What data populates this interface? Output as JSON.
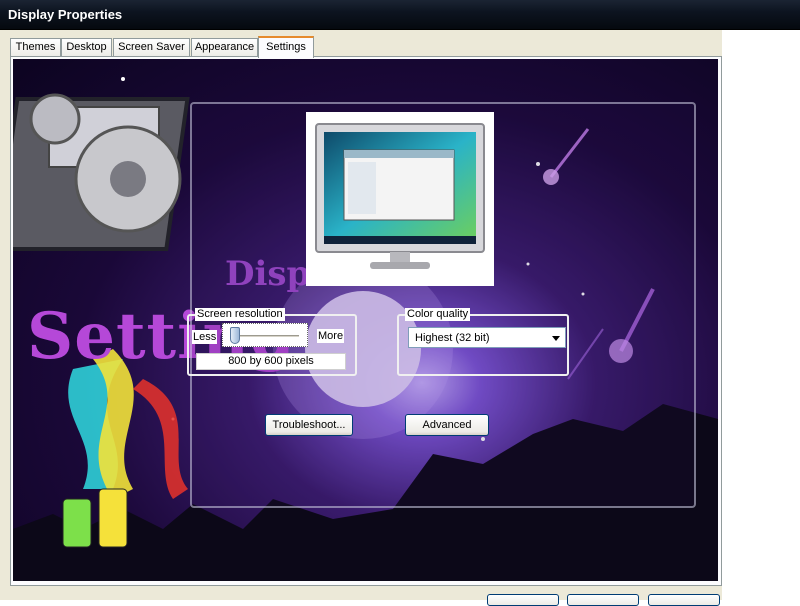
{
  "window": {
    "title": "Display Properties"
  },
  "tabs": [
    {
      "label": "Themes",
      "active": false
    },
    {
      "label": "Desktop",
      "active": false
    },
    {
      "label": "Screen Saver",
      "active": false
    },
    {
      "label": "Appearance",
      "active": false
    },
    {
      "label": "Settings",
      "active": true
    }
  ],
  "background_art": {
    "text_setting": "Setting",
    "text_display": "Displ"
  },
  "screen_resolution": {
    "legend": "Screen resolution",
    "less_label": "Less",
    "more_label": "More",
    "value": "800 by 600 pixels",
    "slider_position": 0.0
  },
  "color_quality": {
    "legend": "Color quality",
    "selected": "Highest (32 bit)"
  },
  "buttons": {
    "troubleshoot": "Troubleshoot...",
    "advanced": "Advanced"
  },
  "colors": {
    "title_bar": "#0d1420",
    "accent_tab": "#e68b2c",
    "art_purple": "#3a1b6d",
    "art_text": "#b548d8"
  },
  "icons": [
    "gear-icon",
    "film-strip-icon",
    "monitor-icon",
    "chevron-down-icon",
    "paint-bottle-icon"
  ]
}
